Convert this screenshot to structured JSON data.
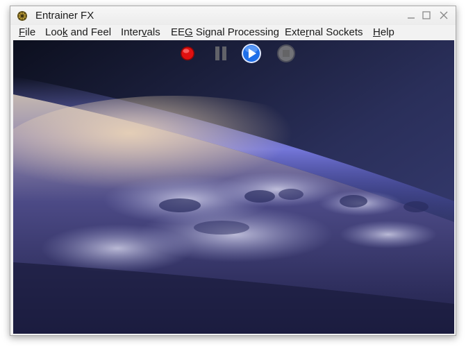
{
  "window": {
    "title": "Entrainer FX"
  },
  "menubar": {
    "items": [
      {
        "pre": "",
        "mnemonic": "F",
        "post": "ile"
      },
      {
        "pre": "Loo",
        "mnemonic": "k",
        "post": " and Feel"
      },
      {
        "pre": "Inter",
        "mnemonic": "v",
        "post": "als"
      },
      {
        "pre": "EE",
        "mnemonic": "G",
        "post": " Signal Processing"
      },
      {
        "pre": "Exte",
        "mnemonic": "r",
        "post": "nal Sockets"
      },
      {
        "pre": "",
        "mnemonic": "H",
        "post": "elp"
      }
    ]
  },
  "controls": {
    "record": {
      "icon": "record-icon",
      "color": "#e01010"
    },
    "pause": {
      "icon": "pause-icon",
      "enabled": false
    },
    "play": {
      "icon": "play-icon",
      "color": "#1e6ee8"
    },
    "stop": {
      "icon": "stop-icon",
      "enabled": false
    }
  },
  "background_image": {
    "subject": "Earth horizon from space with clouds"
  }
}
